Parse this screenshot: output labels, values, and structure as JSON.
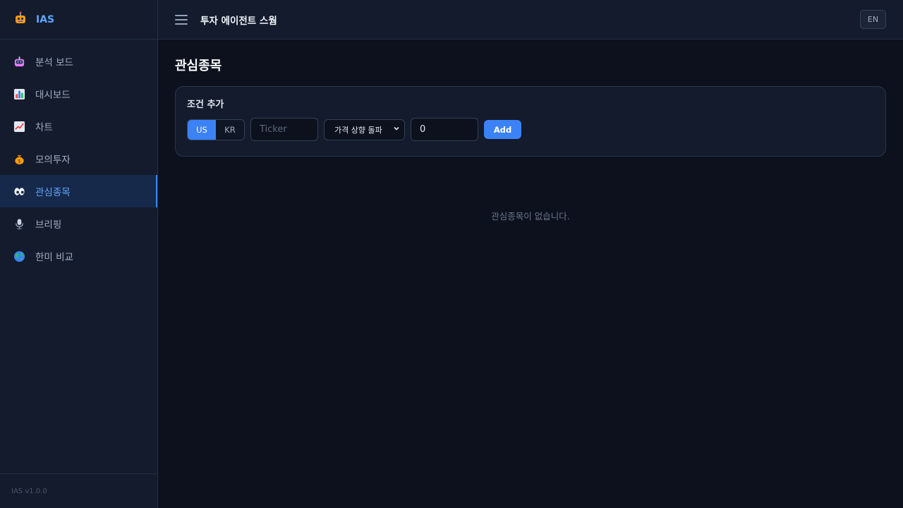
{
  "brand": {
    "name": "IAS",
    "logo_icon": "robot-logo-icon"
  },
  "sidebar": {
    "items": [
      {
        "label": "분석 보드",
        "icon": "robot-icon",
        "active": false
      },
      {
        "label": "대시보드",
        "icon": "bar-chart-icon",
        "active": false
      },
      {
        "label": "차트",
        "icon": "line-chart-icon",
        "active": false
      },
      {
        "label": "모의투자",
        "icon": "money-bag-icon",
        "active": false
      },
      {
        "label": "관심종목",
        "icon": "eyes-icon",
        "active": true
      },
      {
        "label": "브리핑",
        "icon": "microphone-icon",
        "active": false
      },
      {
        "label": "한미 비교",
        "icon": "globe-icon",
        "active": false
      }
    ],
    "version": "IAS v1.0.0"
  },
  "header": {
    "title": "투자 에이전트 스웜",
    "lang_label": "EN"
  },
  "main": {
    "title": "관심종목",
    "card": {
      "title": "조건 추가",
      "market_options": [
        "US",
        "KR"
      ],
      "selected_market": "US",
      "ticker_placeholder": "Ticker",
      "condition_value": "가격 상향 돌파",
      "threshold_value": "0",
      "add_label": "Add"
    },
    "empty_message": "관심종목이 없습니다."
  },
  "colors": {
    "accent": "#3b82f6",
    "accent_text": "#60a5fa",
    "background": "#0c111d",
    "panel": "#131b2c"
  }
}
